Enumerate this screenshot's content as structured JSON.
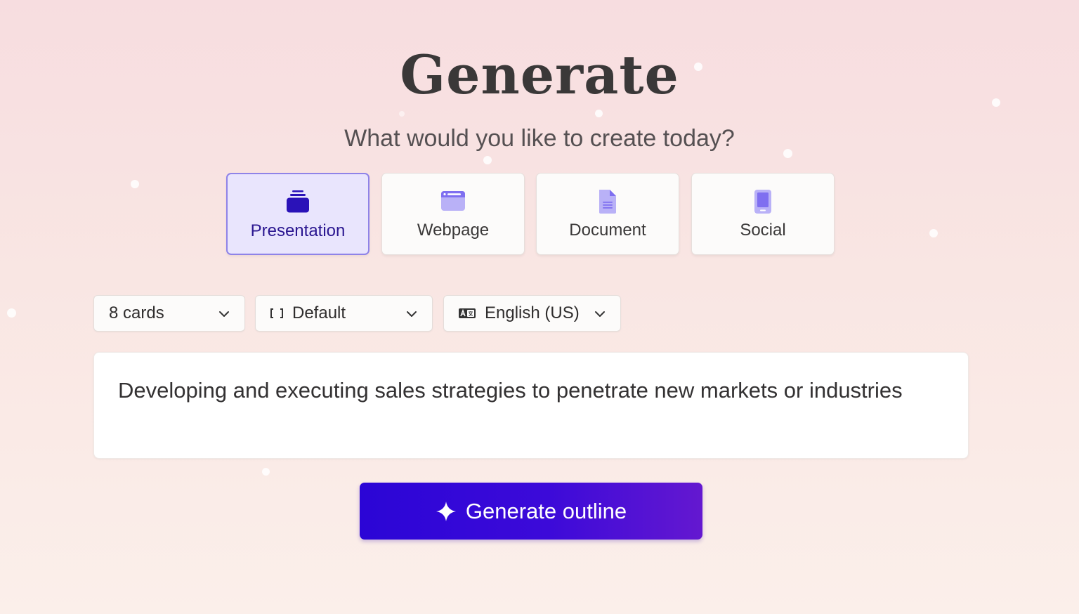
{
  "header": {
    "title": "Generate",
    "subtitle": "What would you like to create today?"
  },
  "content_types": [
    {
      "label": "Presentation",
      "icon": "presentation-stack-icon",
      "selected": true
    },
    {
      "label": "Webpage",
      "icon": "webpage-browser-icon",
      "selected": false
    },
    {
      "label": "Document",
      "icon": "document-icon",
      "selected": false
    },
    {
      "label": "Social",
      "icon": "mobile-phone-icon",
      "selected": false
    }
  ],
  "options": {
    "cards": {
      "value": "8 cards"
    },
    "format": {
      "value": "Default",
      "icon": "frame-brackets-icon"
    },
    "language": {
      "value": "English (US)",
      "icon": "language-translate-icon"
    }
  },
  "prompt": {
    "text": "Developing and executing sales strategies to penetrate new markets or industries"
  },
  "action": {
    "label": "Generate outline",
    "icon": "sparkle-icon"
  },
  "colors": {
    "accent": "#2b05d6",
    "selected_card_bg": "#e9e5fd",
    "selected_card_border": "#8f83e8",
    "selected_label": "#2a1690",
    "icon_purple": "#a99ff5"
  }
}
